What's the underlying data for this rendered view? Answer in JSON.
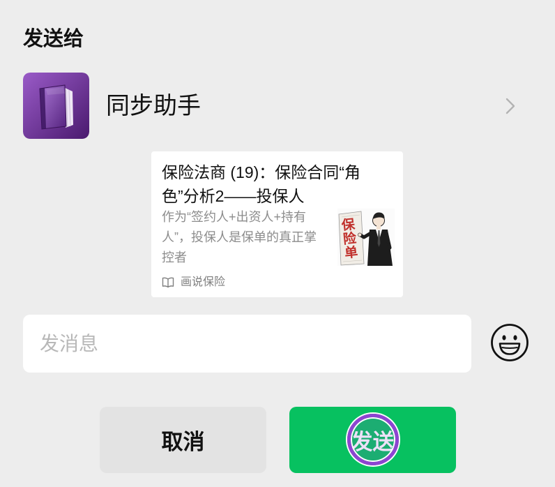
{
  "dialog": {
    "title": "发送给"
  },
  "recipient": {
    "name": "同步助手",
    "avatar_icon": "purple-book-icon",
    "chevron_icon": "chevron-right-icon"
  },
  "article": {
    "title": "保险法商 (19)：保险合同“角色”分析2——投保人",
    "description": "作为“签约人+出资人+持有人”，投保人是保单的真正掌控者",
    "thumbnail_icon": "businessman-pointing-illustration",
    "thumbnail_text": "保险单",
    "source_icon": "open-book-icon",
    "source": "画说保险"
  },
  "message_input": {
    "placeholder": "发消息"
  },
  "emoji_button": {
    "icon": "smiley-face-icon"
  },
  "buttons": {
    "cancel_label": "取消",
    "send_label": "发送"
  },
  "colors": {
    "background": "#ededed",
    "card": "#ffffff",
    "send_button": "#07c160",
    "cancel_button": "#e3e3e3",
    "placeholder": "#b8b8b8",
    "secondary_text": "#8c8c8c",
    "thumbnail_text": "#c0302b",
    "click_indicator": "#8e44d1"
  }
}
